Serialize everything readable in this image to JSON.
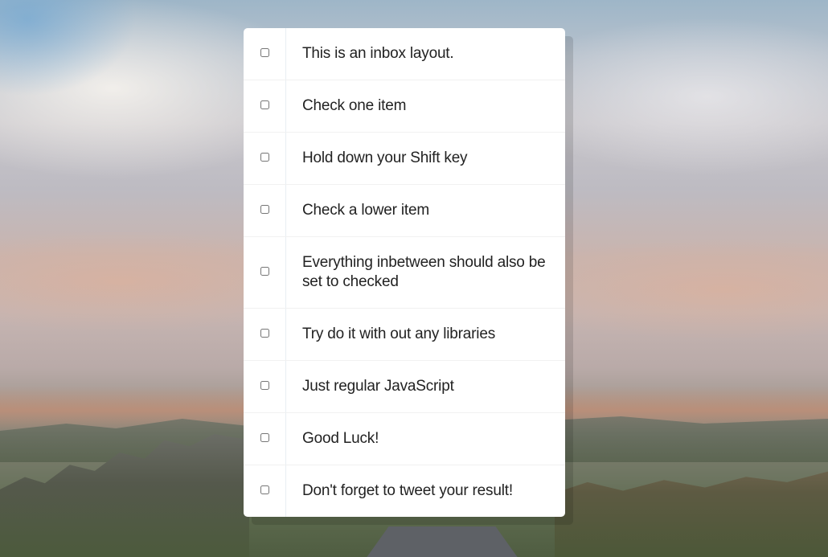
{
  "inbox": {
    "items": [
      {
        "label": "This is an inbox layout.",
        "checked": false
      },
      {
        "label": "Check one item",
        "checked": false
      },
      {
        "label": "Hold down your Shift key",
        "checked": false
      },
      {
        "label": "Check a lower item",
        "checked": false
      },
      {
        "label": "Everything inbetween should also be set to checked",
        "checked": false
      },
      {
        "label": "Try do it with out any libraries",
        "checked": false
      },
      {
        "label": "Just regular JavaScript",
        "checked": false
      },
      {
        "label": "Good Luck!",
        "checked": false
      },
      {
        "label": "Don't forget to tweet your result!",
        "checked": false
      }
    ]
  },
  "colors": {
    "card_background": "#ffffff",
    "text": "#222222",
    "divider": "#f1f1f1"
  }
}
